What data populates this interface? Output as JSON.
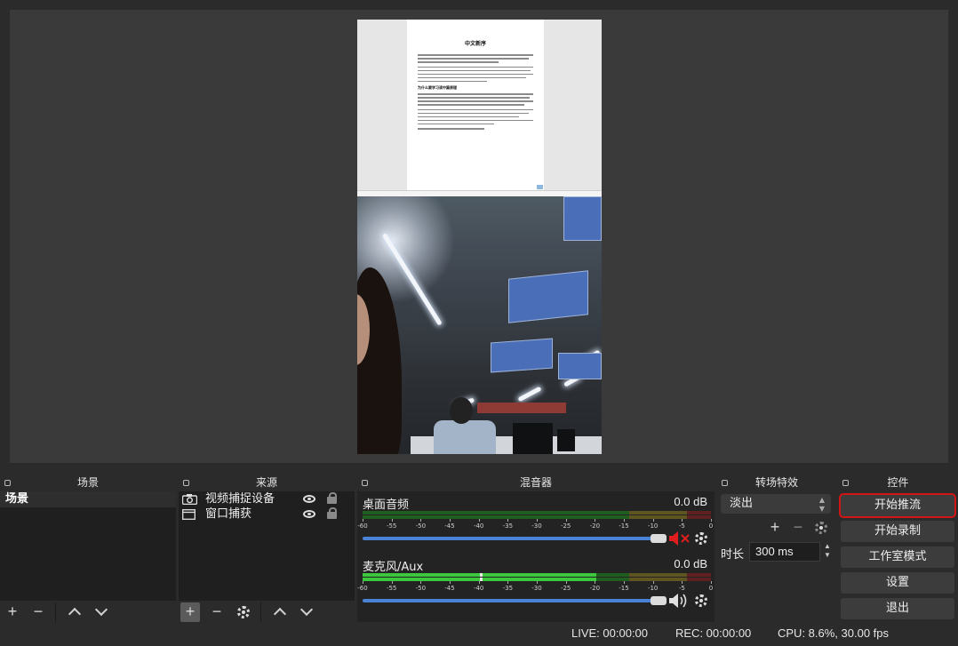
{
  "preview": {
    "doc_title": "中文新序",
    "doc_section": "为什么要学习读中篇原理"
  },
  "docks": {
    "scenes_title": "场景",
    "sources_title": "来源",
    "mixer_title": "混音器",
    "transitions_title": "转场特效",
    "controls_title": "控件"
  },
  "scenes": {
    "items": [
      {
        "label": "场景",
        "selected": true
      }
    ]
  },
  "sources": {
    "items": [
      {
        "label": "视频捕捉设备",
        "icon": "camera-icon",
        "visible": true,
        "locked": false
      },
      {
        "label": "窗口捕获",
        "icon": "window-icon",
        "visible": true,
        "locked": false
      }
    ]
  },
  "mixer": {
    "tick_labels": [
      "-60",
      "-55",
      "-50",
      "-45",
      "-40",
      "-35",
      "-30",
      "-25",
      "-20",
      "-15",
      "-10",
      "-5",
      "0"
    ],
    "channels": [
      {
        "name": "桌面音频",
        "level": "0.0 dB",
        "muted": true,
        "volume": 1.0
      },
      {
        "name": "麦克风/Aux",
        "level": "0.0 dB",
        "muted": false,
        "volume": 1.0
      }
    ]
  },
  "transitions": {
    "selected": "淡出",
    "duration_label": "时长",
    "duration_value": "300 ms"
  },
  "controls": {
    "start_streaming": "开始推流",
    "start_recording": "开始录制",
    "studio_mode": "工作室模式",
    "settings": "设置",
    "exit": "退出"
  },
  "status": {
    "live": "LIVE: 00:00:00",
    "rec": "REC: 00:00:00",
    "cpu": "CPU: 8.6%, 30.00 fps"
  },
  "colors": {
    "meter_green": "#2f9a2f",
    "meter_yellow": "#9a8a2a",
    "meter_red": "#8a2a2a",
    "volume_blue": "#4a82d6",
    "highlight_red": "#d11414",
    "mute_red": "#e01e1e"
  }
}
